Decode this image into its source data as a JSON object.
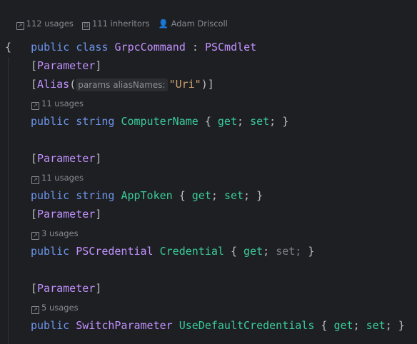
{
  "header": {
    "usages": "112 usages",
    "inheritors": "111 inheritors",
    "author": "Adam Driscoll"
  },
  "lines": {
    "class_kw1": "public",
    "class_kw2": "class",
    "class_name": "GrpcCommand",
    "colon": " : ",
    "base": "PSCmdlet",
    "open_brace": "{",
    "attr1": "Parameter",
    "alias": "Alias",
    "alias_hint": "params aliasNames:",
    "alias_value": "\"Uri\"",
    "usage1": "11 usages",
    "prop1_mod": "public",
    "prop1_type": "string",
    "prop1_name": "ComputerName",
    "attr2": "Parameter",
    "usage2": "11 usages",
    "prop2_mod": "public",
    "prop2_type": "string",
    "prop2_name": "AppToken",
    "attr3": "Parameter",
    "usage3": "3 usages",
    "prop3_mod": "public",
    "prop3_type": "PSCredential",
    "prop3_name": "Credential",
    "attr4": "Parameter",
    "usage4": "5 usages",
    "prop4_mod": "public",
    "prop4_type": "SwitchParameter",
    "prop4_name": "UseDefaultCredentials",
    "get": "get",
    "set": "set"
  },
  "colors": {
    "background": "#1e1f22",
    "keyword": "#6c95eb",
    "class": "#c191ff",
    "property": "#39cc9b",
    "string": "#c9a26d"
  }
}
